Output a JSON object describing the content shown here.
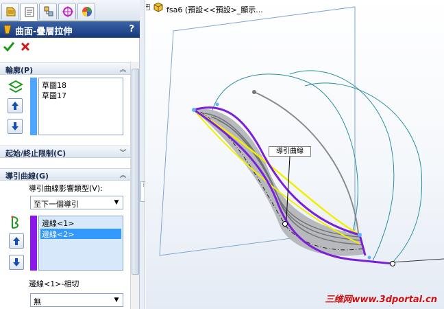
{
  "feature": {
    "title": "曲面-疊層拉伸",
    "help": "?"
  },
  "sections": {
    "profiles": {
      "header": "輪廓(P)",
      "items": [
        "草圖18",
        "草圖17"
      ]
    },
    "constraints": {
      "header": "起始/終止限制(C)"
    },
    "guides": {
      "header": "導引曲線(G)",
      "influence_label": "導引曲線影響類型(V):",
      "influence_value": "至下一個導引",
      "items": [
        "邊線<1>",
        "邊線<2>"
      ],
      "selected_index": 1,
      "tangency_label": "邊線<1>-相切",
      "tangency_value": "無"
    }
  },
  "tree": {
    "text": "fsa6 (預設<<預設>_顯示..."
  },
  "viewport": {
    "callout": "導引曲線"
  },
  "watermark": "三维网www.3dportal.cn",
  "colors": {
    "title_bar": "#17387a",
    "profile_bar": "#4da6ff",
    "guide_bar": "#8a18e6",
    "selection": "#3399ff",
    "edge_purple": "#7b1fd9",
    "edge_yellow": "#f0f000",
    "watermark": "#d01010"
  },
  "icons": [
    "feature-manager-icon",
    "property-manager-icon",
    "configuration-manager-icon",
    "dimxpert-icon",
    "display-manager-icon",
    "loft-icon",
    "ok-check-icon",
    "cancel-x-icon",
    "profile-icon",
    "guide-curve-icon",
    "arrow-up-icon",
    "arrow-down-icon",
    "part-icon"
  ]
}
